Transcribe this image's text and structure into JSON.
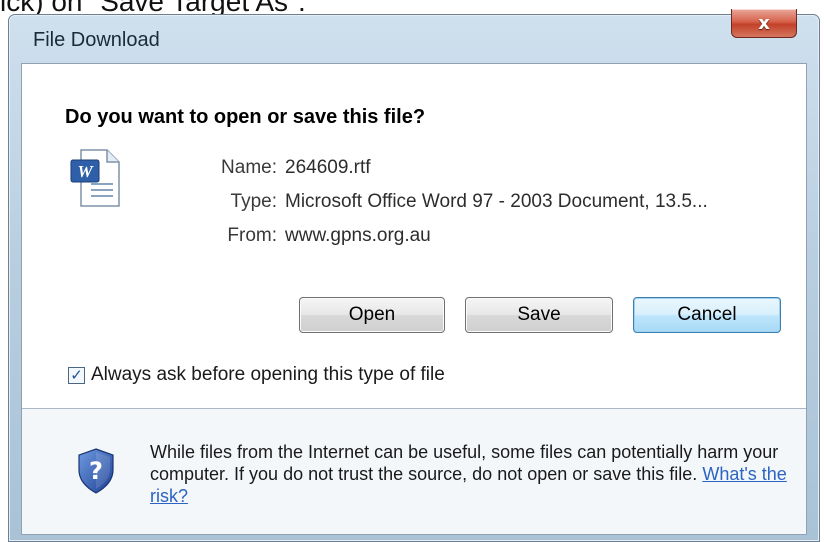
{
  "top_partial_text": "ick) on \"Save Target As\".",
  "window": {
    "title": "File Download",
    "close_symbol": "x"
  },
  "dialog": {
    "question": "Do you want to open or save this file?",
    "file_icon": "word-document-icon",
    "info": [
      {
        "label": "Name:",
        "value": "264609.rtf"
      },
      {
        "label": "Type:",
        "value": "Microsoft Office Word 97 - 2003 Document, 13.5..."
      },
      {
        "label": "From:",
        "value": "www.gpns.org.au"
      }
    ],
    "buttons": {
      "open": "Open",
      "save": "Save",
      "cancel": "Cancel"
    },
    "always_ask": {
      "label": "Always ask before opening this type of file",
      "checked": true
    },
    "warning": {
      "icon": "shield-question-icon",
      "text": "While files from the Internet can be useful, some files can potentially harm your computer. If you do not trust the source, do not open or save this file.",
      "link": "What's the risk?"
    }
  },
  "colors": {
    "frame": "#b9cfe0",
    "close_button": "#c2412a",
    "link": "#2b64c2",
    "default_button": "#3c7fb1"
  }
}
